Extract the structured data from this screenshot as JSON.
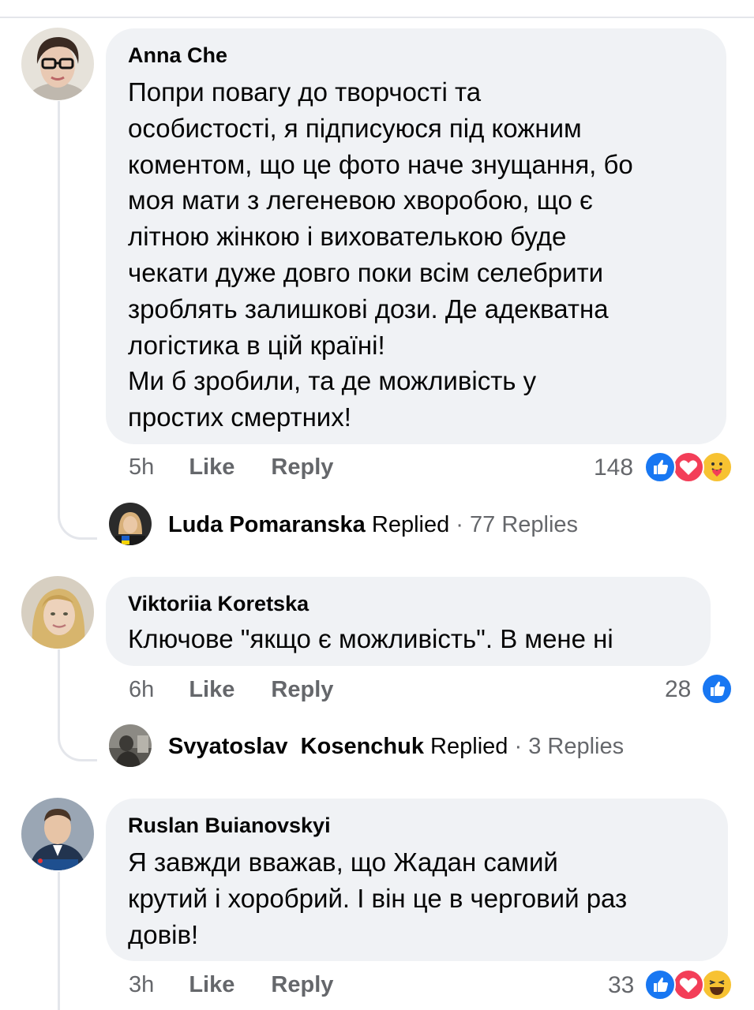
{
  "comments": [
    {
      "author": "Anna Che",
      "text": "Попри повагу до творчості та\nособистості, я підписуюся під кожним\nкоментом, що це фото наче знущання, бо\nмоя мати з легеневою хворобою, що є\nлітною жінкою і вихователькою буде\nчекати дуже довго поки всім селебрити\nзроблять залишкові дози. Де адекватна\nлогістика в цій країні!\nМи б зробили, та де можливість у\nпростих смертних!",
      "time": "5h",
      "like_label": "Like",
      "reply_label": "Reply",
      "reaction_count": "148",
      "reactions": [
        "like-icon",
        "love-icon",
        "care-icon"
      ],
      "replies": {
        "name": "Luda Pomaranska",
        "replied_label": "Replied",
        "separator": "·",
        "count_label": "77 Replies"
      }
    },
    {
      "author": "Viktoriia Koretska",
      "text": "Ключове \"якщо є можливість\". В мене ні",
      "time": "6h",
      "like_label": "Like",
      "reply_label": "Reply",
      "reaction_count": "28",
      "reactions": [
        "like-icon"
      ],
      "replies": {
        "name": "Svyatoslav  Kosenchuk",
        "replied_label": "Replied",
        "separator": "·",
        "count_label": "3 Replies"
      }
    },
    {
      "author": "Ruslan Buianovskyi",
      "text": "Я завжди вважав, що Жадан самий\nкрутий і хоробрий. І він це в черговий раз\nдовів!",
      "time": "3h",
      "like_label": "Like",
      "reply_label": "Reply",
      "reaction_count": "33",
      "reactions": [
        "like-icon",
        "love-icon",
        "haha-icon"
      ]
    }
  ],
  "colors": {
    "bubble": "#f0f2f5",
    "muted_text": "#65676b",
    "like_blue": "#1877f2",
    "love_red": "#f33e58",
    "emoji_yellow": "#f7c232"
  }
}
